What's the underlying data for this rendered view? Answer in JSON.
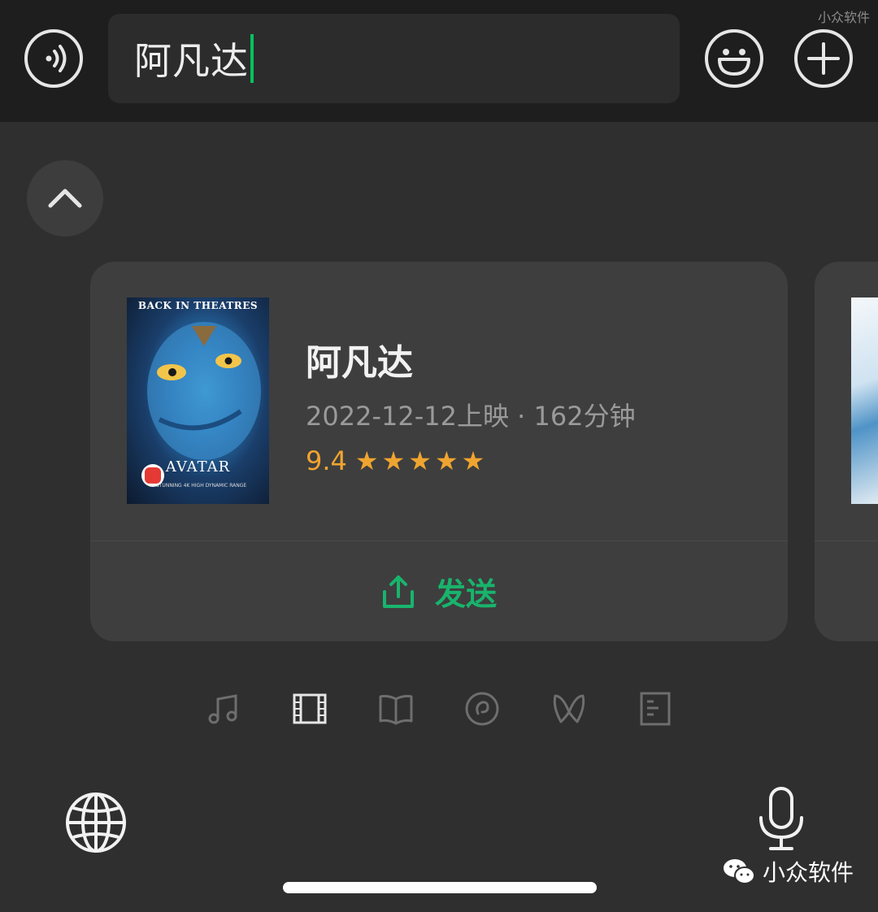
{
  "input": {
    "text": "阿凡达"
  },
  "watermark": {
    "top": "小众软件",
    "bottom": "小众软件"
  },
  "card": {
    "title": "阿凡达",
    "meta": "2022-12-12上映 · 162分钟",
    "rating": "9.4",
    "stars": "★★★★★",
    "send_label": "发送",
    "poster": {
      "top_text": "BACK IN THEATRES",
      "title": "AVATAR",
      "sub": "IN STUNNING 4K HIGH DYNAMIC RANGE"
    }
  },
  "colors": {
    "accent": "#07c160",
    "rating": "#f0a430",
    "send": "#18b46c",
    "card_bg": "#3e3e3e",
    "bg": "#2f2f2f",
    "top_bar": "#1e1e1e"
  },
  "tabs": [
    {
      "icon": "music-note-icon",
      "selected": false
    },
    {
      "icon": "film-icon",
      "selected": true
    },
    {
      "icon": "book-icon",
      "selected": false
    },
    {
      "icon": "podcast-icon",
      "selected": false
    },
    {
      "icon": "butterfly-icon",
      "selected": false
    },
    {
      "icon": "document-icon",
      "selected": false
    }
  ]
}
